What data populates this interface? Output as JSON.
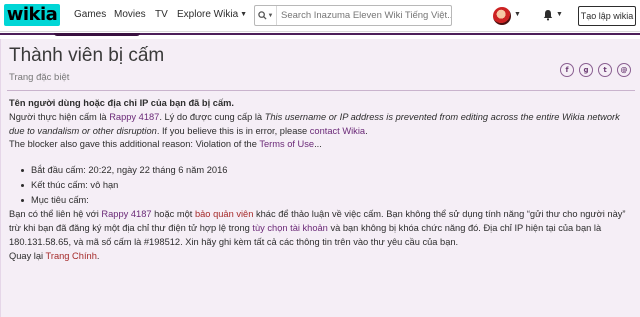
{
  "global_nav": {
    "logo": "wikia",
    "links": [
      "Games",
      "Movies",
      "TV"
    ],
    "explore_label": "Explore Wikia",
    "search_placeholder": "Search Inazuma Eleven Wiki Tiếng Việt...",
    "create_button": "Tạo lập wikia",
    "icons": [
      "search-icon",
      "chevron-down-icon",
      "avatar",
      "bell-icon"
    ]
  },
  "colors": {
    "logo_bg": "#00d6d6",
    "page_bg": "#f5eef6",
    "link": "#6b2a78",
    "red_link": "#a52a2a",
    "header_strip": "#4d1f5a"
  },
  "page": {
    "title": "Thành viên bị cấm",
    "subtitle": "Trang đặc biệt",
    "share_icons": [
      "facebook-icon",
      "google-plus-icon",
      "twitter-icon",
      "email-icon"
    ],
    "share_glyphs": [
      "f",
      "g",
      "t",
      "@"
    ]
  },
  "content": {
    "heading": "Tên người dùng hoặc địa chỉ IP của bạn đã bị cấm.",
    "p1": {
      "pre": "Người thực hiện cấm là ",
      "user_link": "Rappy 4187",
      "mid": ". Lý do được cung cấp là ",
      "reason": "This username or IP address is prevented from editing across the entire Wikia network due to vandalism or other disruption",
      "after_reason": ". If you believe this is in error, please ",
      "contact_link": "contact Wikia",
      "end": "."
    },
    "p2": {
      "pre": "The blocker also gave this additional reason: Violation of the ",
      "terms_link": "Terms of Use",
      "end": "..."
    },
    "details": [
      "Bắt đầu cấm: 20:22, ngày 22 tháng 6 năm 2016",
      "Kết thúc cấm: vô hạn",
      "Mục tiêu cấm:"
    ],
    "p3": {
      "a": "Bạn có thể liên hệ với ",
      "user_link": "Rappy 4187",
      "b": " hoặc một ",
      "admin_link": "bảo quản viên",
      "c": " khác để thảo luận về việc cấm. Bạn không thể sử dụng tính năng “gửi thư cho người này” trừ khi bạn đã đăng ký một địa chỉ thư điện tử hợp lệ trong ",
      "prefs_link": "tùy chọn tài khoản",
      "d": " và bạn không bị khóa chức năng đó. Địa chỉ IP hiện tại của bạn là 180.131.58.65, và mã số cấm là #198512. Xin hãy ghi kèm tất cả các thông tin trên vào thư yêu cầu của bạn."
    },
    "return": {
      "pre": "Quay lại ",
      "link": "Trang Chính",
      "end": "."
    }
  }
}
